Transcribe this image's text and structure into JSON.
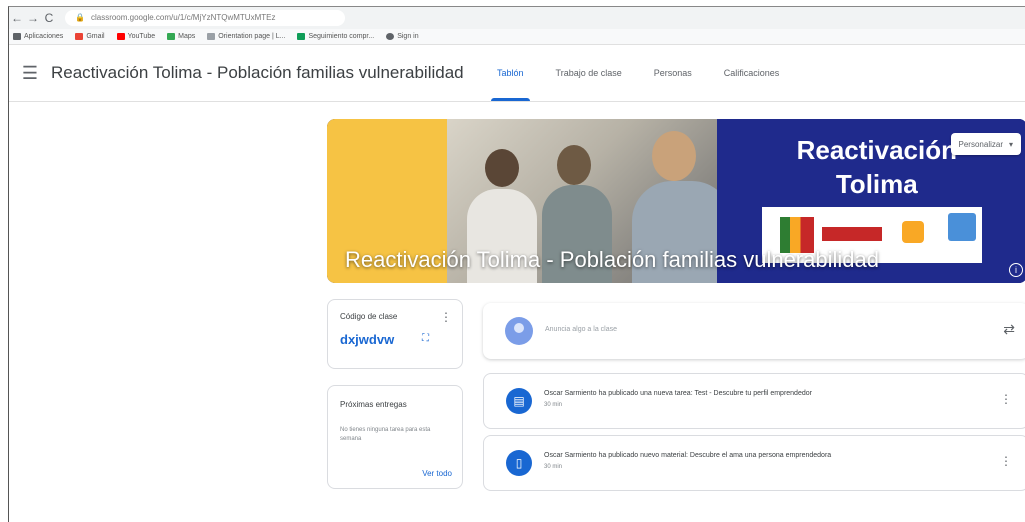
{
  "browser": {
    "nav": {
      "back": "←",
      "forward": "→",
      "reload": "C"
    },
    "url": "classroom.google.com/u/1/c/MjYzNTQwMTUxMTEz",
    "bookmarks": [
      {
        "label": "Aplicaciones",
        "color": "#5f6368"
      },
      {
        "label": "Gmail",
        "color": "#ea4335"
      },
      {
        "label": "YouTube",
        "color": "#ff0000"
      },
      {
        "label": "Maps",
        "color": "#34a853"
      },
      {
        "label": "Orientation page | L...",
        "color": "#9aa0a6"
      },
      {
        "label": "Seguimiento compr...",
        "color": "#0f9d58"
      },
      {
        "label": "Sign in",
        "color": "#5f6368"
      }
    ]
  },
  "header": {
    "menu_icon": "☰",
    "course_title": "Reactivación Tolima - Población familias vulnerabilidad",
    "tabs": [
      {
        "label": "Tablón",
        "active": true
      },
      {
        "label": "Trabajo de clase",
        "active": false
      },
      {
        "label": "Personas",
        "active": false
      },
      {
        "label": "Calificaciones",
        "active": false
      }
    ]
  },
  "banner": {
    "headline_line1": "Reactivación",
    "headline_line2": "Tolima",
    "title": "Reactivación Tolima - Población familias vulnerabilidad",
    "customize_label": "Personalizar",
    "customize_caret": "▾",
    "info_icon": "i"
  },
  "class_code": {
    "label": "Código de clase",
    "value": "dxjwdvw",
    "more_icon": "⋮",
    "fullscreen_icon": "⛶"
  },
  "upcoming": {
    "title": "Próximas entregas",
    "empty_text": "No tienes ninguna tarea para esta semana",
    "view_all": "Ver todo"
  },
  "stream": {
    "announce_placeholder": "Anuncia algo a la clase",
    "reuse_icon": "⇄",
    "posts": [
      {
        "icon": "▤",
        "text": "Oscar Sarmiento ha publicado una nueva tarea: Test - Descubre tu perfil emprendedor",
        "time": "30 min",
        "more_icon": "⋮"
      },
      {
        "icon": "▯",
        "text": "Oscar Sarmiento ha publicado nuevo material: Descubre el ama una persona emprendedora",
        "time": "30 min",
        "more_icon": "⋮"
      }
    ]
  },
  "colors": {
    "accent": "#1967d2",
    "banner_blue": "#1f2a8c",
    "banner_yellow": "#f6c344"
  }
}
